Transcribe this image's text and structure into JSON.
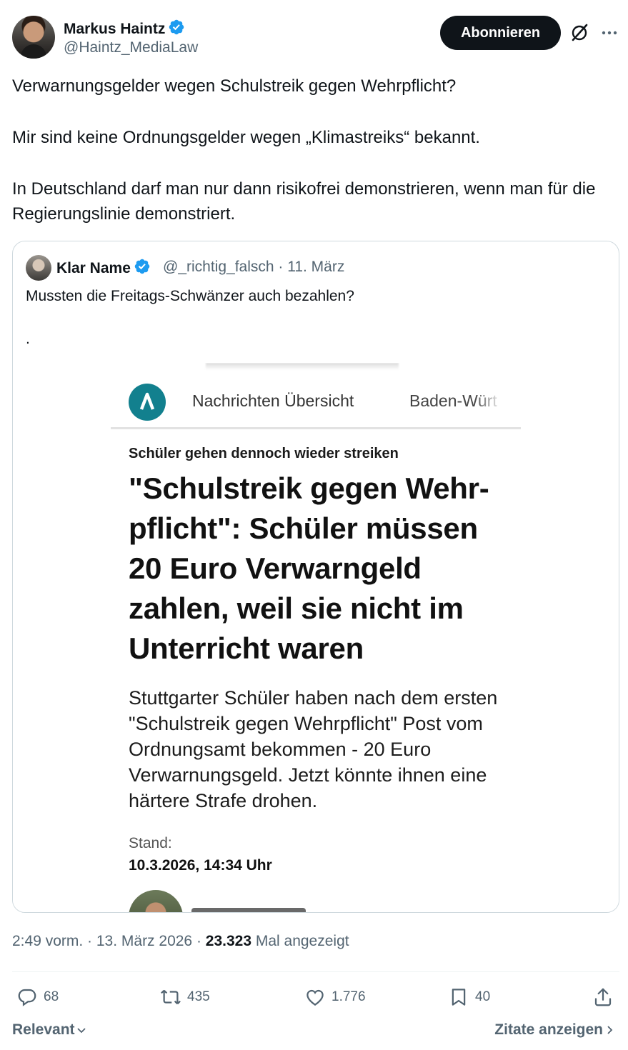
{
  "author": {
    "name": "Markus Haintz",
    "handle": "@Haintz_MediaLaw",
    "verified": true
  },
  "header": {
    "follow_label": "Abonnieren",
    "icons": [
      "grok-icon",
      "more-icon"
    ]
  },
  "post": {
    "paragraphs": [
      "Verwarnungsgelder wegen Schulstreik gegen Wehrpflicht?",
      "Mir sind keine Ordnungsgelder wegen „Klimastreiks“ bekannt.",
      "In Deutschland darf man nur dann risikofrei demonstrieren, wenn man für die Regierungslinie demonstriert."
    ]
  },
  "quote": {
    "name": "Klar Name",
    "handle_date": "@_richtig_falsch · 11. März",
    "text": "Mussten die Freitags-Schwänzer auch bezahlen?",
    "dot": ".",
    "screenshot": {
      "nav_item_1": "Nachrichten Übersicht",
      "nav_item_2": "Baden-Würt",
      "kicker": "Schüler gehen dennoch wieder streiken",
      "headline": "\"Schulstreik gegen Wehr­pflicht\": Schüler müssen 20 Euro Verwarngeld zahlen, weil sie nicht im Unterricht waren",
      "teaser": "Stuttgarter Schüler haben nach dem ersten \"Schulstreik gegen Wehrpflicht\" Post vom Ordnungsamt bekommen - 20 Euro Verwarnungsgeld. Jetzt könnte ihnen eine härtere Strafe drohen.",
      "stand_label": "Stand:",
      "stand_date": "10.3.2026, 14:34 Uhr"
    }
  },
  "meta": {
    "time_date": "2:49 vorm. · 13. März 2026 · ",
    "views_count": "23.323",
    "views_label": " Mal angezeigt"
  },
  "actions": {
    "replies": "68",
    "reposts": "435",
    "likes": "1.776",
    "bookmarks": "40"
  },
  "footer": {
    "sort_label": "Relevant",
    "quotes_label": "Zitate anzeigen"
  },
  "colors": {
    "verified": "#1d9bf0",
    "muted": "#536471",
    "text": "#0f1419",
    "brand_logo": "#12808e"
  }
}
